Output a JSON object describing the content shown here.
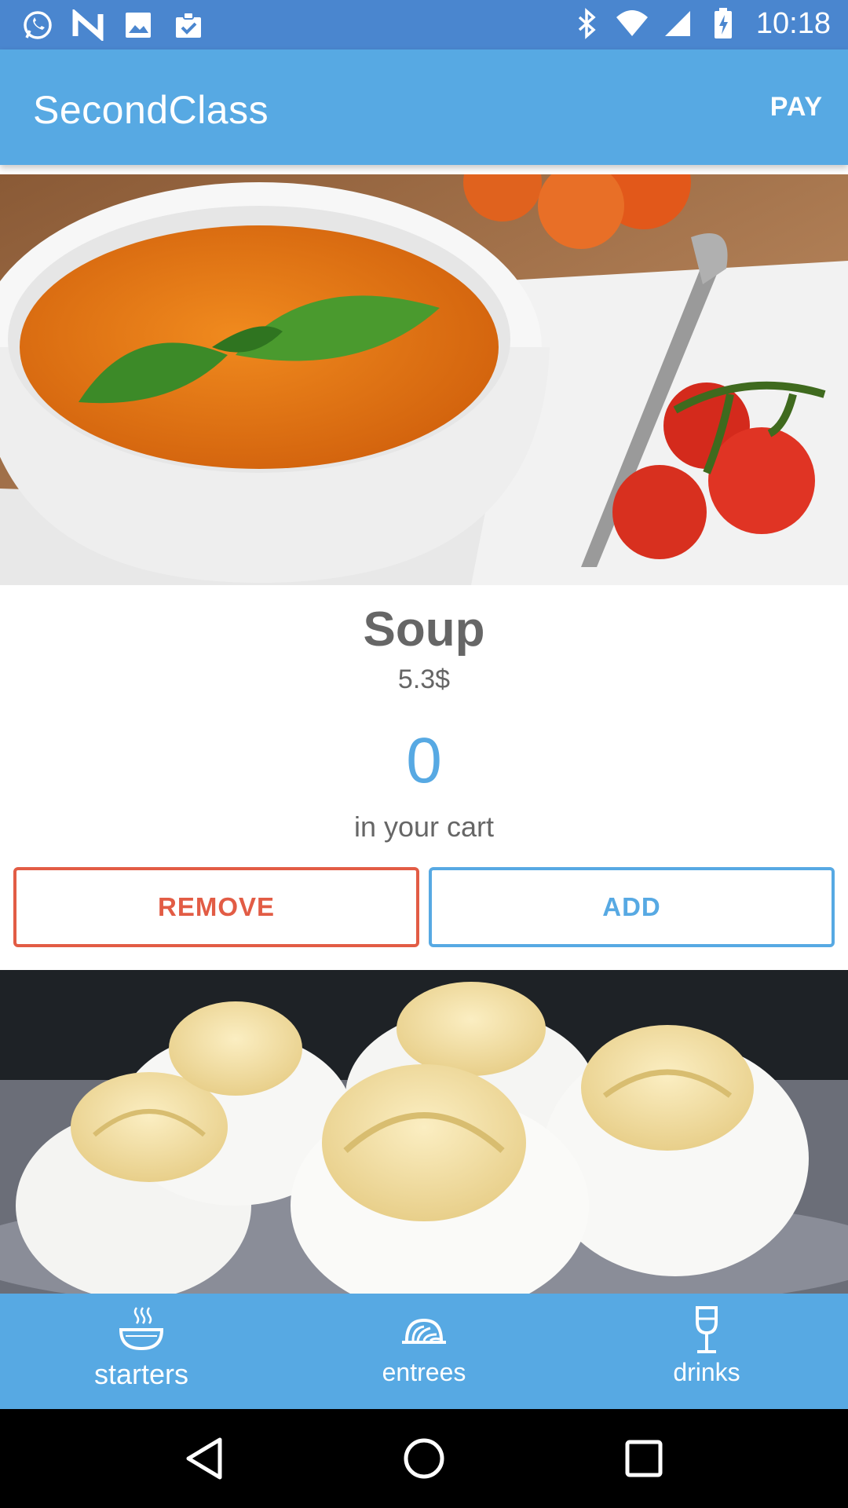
{
  "status_bar": {
    "time": "10:18",
    "icons_left": [
      "whatsapp-icon",
      "n-notification-icon",
      "image-icon",
      "clipboard-check-icon"
    ],
    "icons_right": [
      "bluetooth-icon",
      "wifi-icon",
      "cell-signal-icon",
      "battery-charging-icon"
    ]
  },
  "app_bar": {
    "title": "SecondClass",
    "action_label": "PAY"
  },
  "card": {
    "image_icon": "tomato-soup-photo",
    "name": "Soup",
    "price": "5.3$",
    "count": "0",
    "count_label": "in your cart",
    "remove_label": "REMOVE",
    "add_label": "ADD"
  },
  "next_card": {
    "image_icon": "deviled-eggs-photo"
  },
  "bottom_nav": {
    "items": [
      {
        "label": "starters",
        "icon": "soup-bowl-icon",
        "active": true
      },
      {
        "label": "entrees",
        "icon": "dish-icon",
        "active": false
      },
      {
        "label": "drinks",
        "icon": "wine-glass-icon",
        "active": false
      }
    ]
  },
  "colors": {
    "status_bar": "#4a86cf",
    "primary": "#57a9e3",
    "remove": "#e25c45",
    "text_gray": "#666666"
  }
}
